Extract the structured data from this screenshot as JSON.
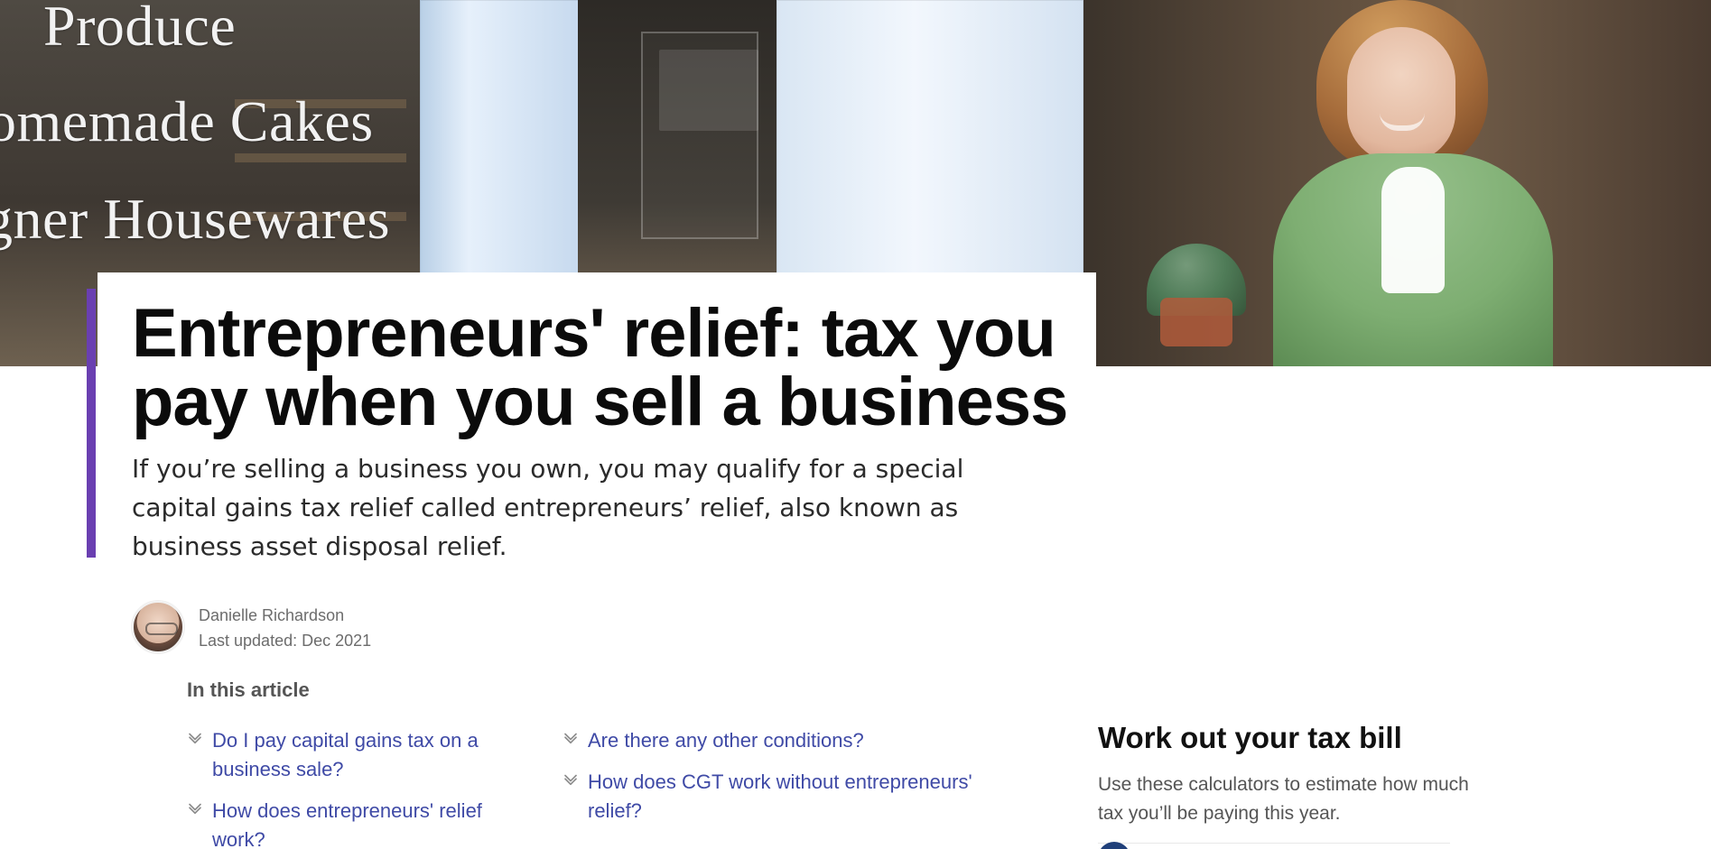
{
  "hero": {
    "sign_lines": [
      "Produce",
      "omemade Cakes",
      "gner Housewares"
    ]
  },
  "article": {
    "title": "Entrepreneurs' relief: tax you pay when you sell a business",
    "subtitle": "If you’re selling a business you own, you may qualify for a special capital gains tax relief called entrepreneurs’ relief, also known as business asset disposal relief.",
    "author": {
      "name": "Danielle Richardson",
      "updated": "Last updated: Dec 2021"
    },
    "in_this_article": {
      "label": "In this article",
      "items_col1": [
        "Do I pay capital gains tax on a business sale?",
        "How does entrepreneurs' relief work?"
      ],
      "items_col2": [
        "Are there any other conditions?",
        "How does CGT work without entrepreneurs' relief?"
      ]
    }
  },
  "sidebar": {
    "title": "Work out your tax bill",
    "description": "Use these calculators to estimate how much tax you’ll be paying this year."
  },
  "colors": {
    "accent_bar": "#6a3fb1",
    "toc_link": "#3f4aa6"
  },
  "icons": {
    "toc": "chevron-down-icon"
  }
}
